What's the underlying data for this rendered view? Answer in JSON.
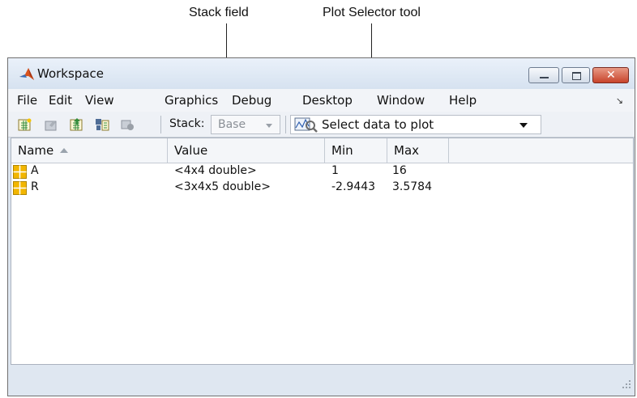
{
  "callouts": {
    "stack_field": "Stack field",
    "plot_selector": "Plot Selector tool"
  },
  "window": {
    "title": "Workspace",
    "buttons": [
      "minimize-icon",
      "maximize-icon",
      "close-icon"
    ]
  },
  "menu": {
    "items": [
      "File",
      "Edit",
      "View",
      "Graphics",
      "Debug",
      "Desktop",
      "Window",
      "Help"
    ]
  },
  "toolbar": {
    "icons": [
      "new-variable-icon",
      "open-variable-icon",
      "load-data-icon",
      "save-workspace-icon",
      "delete-icon"
    ],
    "stack_label": "Stack:",
    "stack_value": "Base",
    "plot_selector_label": "Select data to plot"
  },
  "table": {
    "columns": [
      "Name",
      "Value",
      "Min",
      "Max"
    ],
    "sort_indicator": "ascending",
    "rows": [
      {
        "name": "A",
        "value": "<4x4 double>",
        "min": "1",
        "max": "16"
      },
      {
        "name": "R",
        "value": "<3x4x5 double>",
        "min": "-2.9443",
        "max": "3.5784"
      }
    ]
  },
  "colors": {
    "window_frame": "#dfe7f1",
    "close_button": "#c8442b",
    "variable_icon": "#f2b600"
  }
}
